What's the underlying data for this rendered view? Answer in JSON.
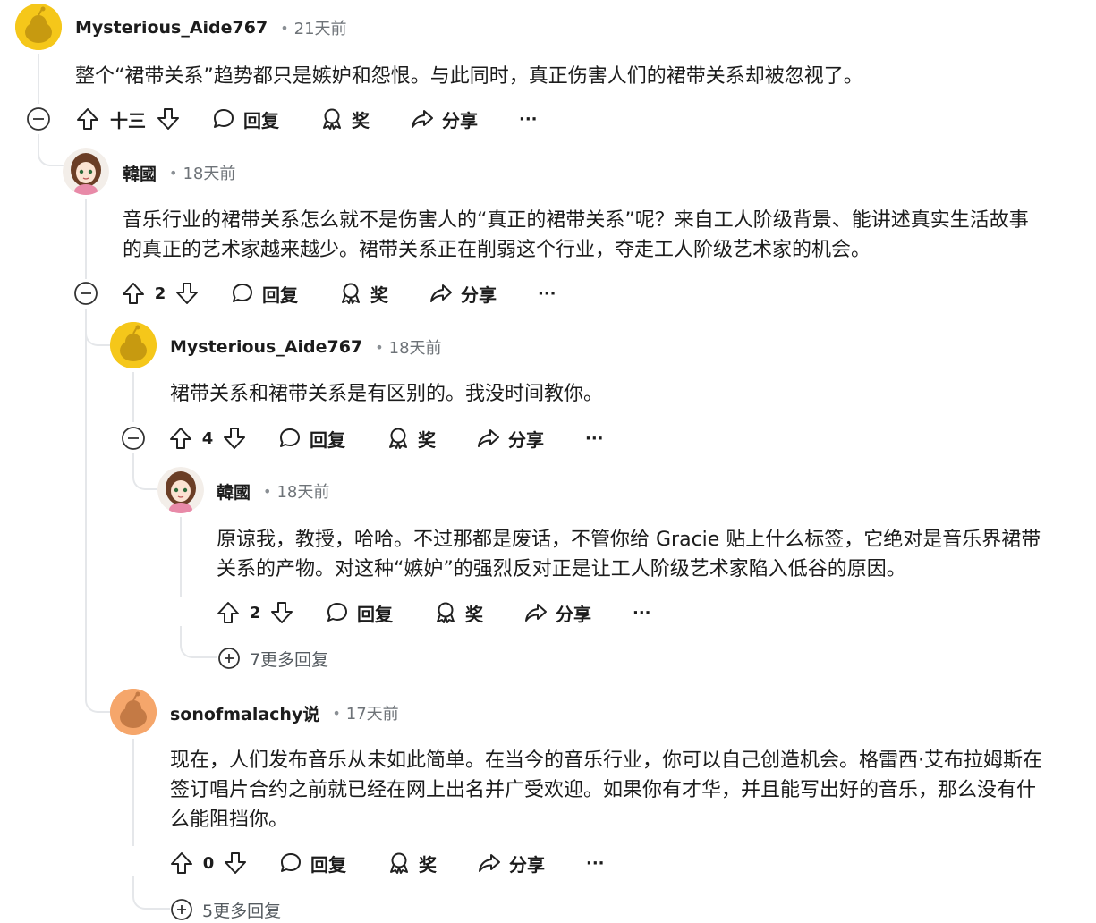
{
  "labels": {
    "reply": "回复",
    "award": "奖",
    "share": "分享",
    "more": "···"
  },
  "comments": [
    {
      "author": "Mysterious_Aide767",
      "dot": "•",
      "time": "21天前",
      "body": "整个“裙带关系”趋势都只是嫉妒和怨恨。与此同时，真正伤害人们的裙带关系却被忽视了。",
      "score": "十三",
      "avatar": "snoo-yellow"
    },
    {
      "author": "韓國",
      "dot": "•",
      "time": "18天前",
      "body": "音乐行业的裙带关系怎么就不是伤害人的“真正的裙带关系”呢？来自工人阶级背景、能讲述真实生活故事\n的真正的艺术家越来越少。裙带关系正在削弱这个行业，夺走工人阶级艺术家的机会。",
      "score": "2",
      "avatar": "anime-girl"
    },
    {
      "author": "Mysterious_Aide767",
      "dot": "•",
      "time": "18天前",
      "body": "裙带关系和裙带关系是有区别的。我没时间教你。",
      "score": "4",
      "avatar": "snoo-yellow"
    },
    {
      "author": "韓國",
      "dot": "•",
      "time": "18天前",
      "body": "原谅我，教授，哈哈。不过那都是废话，不管你给 Gracie 贴上什么标签，它绝对是音乐界裙带\n关系的产物。对这种“嫉妒”的强烈反对正是让工人阶级艺术家陷入低谷的原因。",
      "score": "2",
      "avatar": "anime-girl"
    },
    {
      "author": "sonofmalachy说",
      "dot": "•",
      "time": "17天前",
      "body": "现在，人们发布音乐从未如此简单。在当今的音乐行业，你可以自己创造机会。格雷西·艾布拉姆斯在\n签订唱片合约之前就已经在网上出名并广受欢迎。如果你有才华，并且能写出好的音乐，那么没有什\n么能阻挡你。",
      "score": "0",
      "avatar": "snoo-orange"
    }
  ],
  "more_replies": [
    {
      "text": "7更多回复"
    },
    {
      "text": "5更多回复"
    }
  ],
  "colors": {
    "snoo_yellow_bg": "#f5c71a",
    "snoo_orange_bg": "#f5a66b",
    "thread_line": "#e5e7ea"
  }
}
